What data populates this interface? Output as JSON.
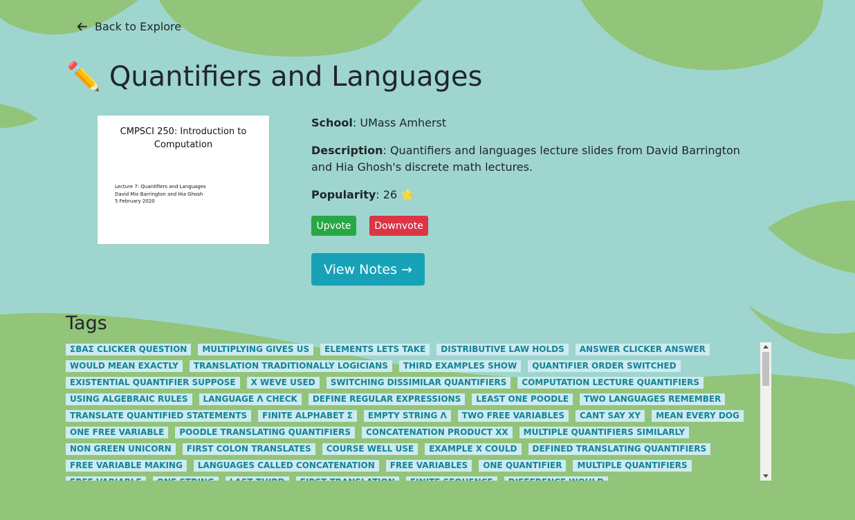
{
  "nav": {
    "back_label": "Back to Explore"
  },
  "page": {
    "title": "Quantifiers and Languages",
    "title_emoji": "✏️"
  },
  "thumbnail": {
    "title": "CMPSCI 250: Introduction to Computation",
    "lines": [
      "Lecture 7: Quantifiers and Languages",
      "David Mix Barrington and Hia Ghosh",
      "5 February 2020"
    ]
  },
  "info": {
    "school_label": "School",
    "school_value": ": UMass Amherst",
    "description_label": "Description",
    "description_value": ": Quantifiers and languages lecture slides from David Barrington and Hia Ghosh's discrete math lectures.",
    "popularity_label": "Popularity",
    "popularity_value": ": 26",
    "popularity_icon": "⭐"
  },
  "actions": {
    "upvote": "Upvote",
    "downvote": "Downvote",
    "view_notes": "View Notes →"
  },
  "tags": {
    "heading": "Tags",
    "items": [
      "ΣΒΑΣ CLICKER QUESTION",
      "MULTIPLYING GIVES US",
      "ELEMENTS LETS TAKE",
      "DISTRIBUTIVE LAW HOLDS",
      "ANSWER CLICKER ANSWER",
      "WOULD MEAN EXACTLY",
      "TRANSLATION TRADITIONALLY LOGICIANS",
      "THIRD EXAMPLES SHOW",
      "QUANTIFIER ORDER SWITCHED",
      "EXISTENTIAL QUANTIFIER SUPPOSE",
      "X WEVE USED",
      "SWITCHING DISSIMILAR QUANTIFIERS",
      "COMPUTATION LECTURE QUANTIFIERS",
      "USING ALGEBRAIC RULES",
      "LANGUAGE Λ CHECK",
      "DEFINE REGULAR EXPRESSIONS",
      "LEAST ONE POODLE",
      "TWO LANGUAGES REMEMBER",
      "TRANSLATE QUANTIFIED STATEMENTS",
      "FINITE ALPHABET Σ",
      "EMPTY STRING Λ",
      "TWO FREE VARIABLES",
      "CANT SAY XY",
      "MEAN EVERY DOG",
      "ONE FREE VARIABLE",
      "POODLE TRANSLATING QUANTIFIERS",
      "CONCATENATION PRODUCT XX",
      "MULTIPLE QUANTIFIERS SIMILARLY",
      "NON GREEN UNICORN",
      "FIRST COLON TRANSLATES",
      "COURSE WELL USE",
      "EXAMPLE X COULD",
      "DEFINED TRANSLATING QUANTIFIERS",
      "FREE VARIABLE MAKING",
      "LANGUAGES CALLED CONCATENATION",
      "FREE VARIABLES",
      "ONE QUANTIFIER",
      "MULTIPLE QUANTIFIERS",
      "FREE VARIABLE",
      "ONE STRING",
      "LAST THIRD",
      "FIRST TRANSLATION",
      "FINITE SEQUENCE",
      "DIFFERENCE WOULD"
    ]
  },
  "colors": {
    "background": "#9ed6cf",
    "leaf": "#92c47a",
    "tag_bg": "#cdebf0",
    "tag_text": "#138496",
    "upvote": "#28a745",
    "downvote": "#dc3545",
    "view_notes": "#17a2b8"
  }
}
